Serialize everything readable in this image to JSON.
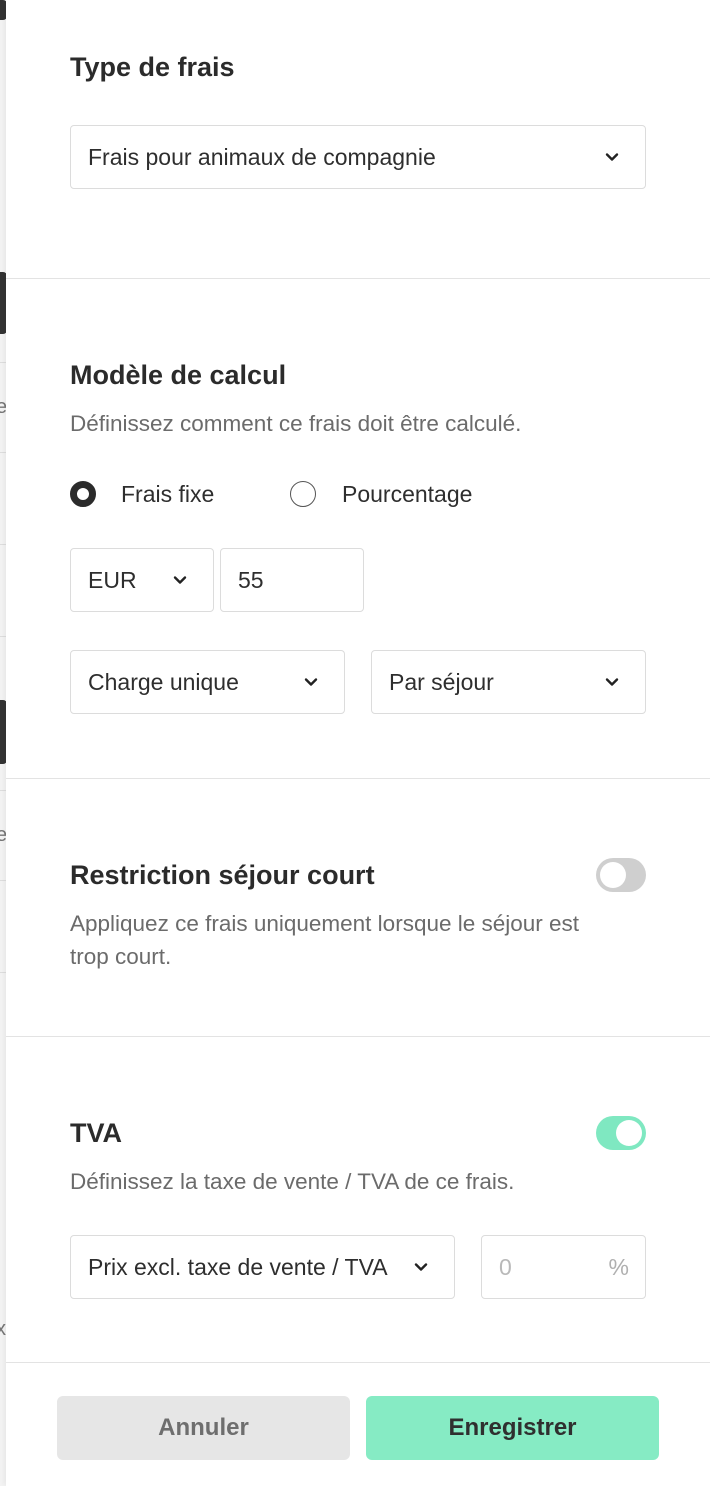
{
  "backdrop": {
    "glyphs": [
      "e",
      "e",
      "x"
    ]
  },
  "fee_type": {
    "heading": "Type de frais",
    "selected": "Frais pour animaux de compagnie"
  },
  "calculation": {
    "heading": "Modèle de calcul",
    "description": "Définissez comment ce frais doit être calculé.",
    "options": [
      {
        "label": "Frais fixe",
        "selected": true
      },
      {
        "label": "Pourcentage",
        "selected": false
      }
    ],
    "currency": "EUR",
    "amount": "55",
    "charge_mode": "Charge unique",
    "charge_basis": "Par séjour"
  },
  "short_stay": {
    "heading": "Restriction séjour court",
    "description_line1": "Appliquez ce frais uniquement lorsque le séjour est",
    "description_line2": "trop court.",
    "enabled": false
  },
  "vat": {
    "heading": "TVA",
    "description": "Définissez la taxe de vente / TVA de ce frais.",
    "enabled": true,
    "price_mode": "Prix excl. taxe de vente / TVA",
    "rate_placeholder": "0",
    "rate_suffix": "%"
  },
  "footer": {
    "cancel_label": "Annuler",
    "save_label": "Enregistrer"
  },
  "colors": {
    "accent": "#86ebc4",
    "toggle_on": "#7fe8c1",
    "toggle_off": "#cfcfcf"
  }
}
